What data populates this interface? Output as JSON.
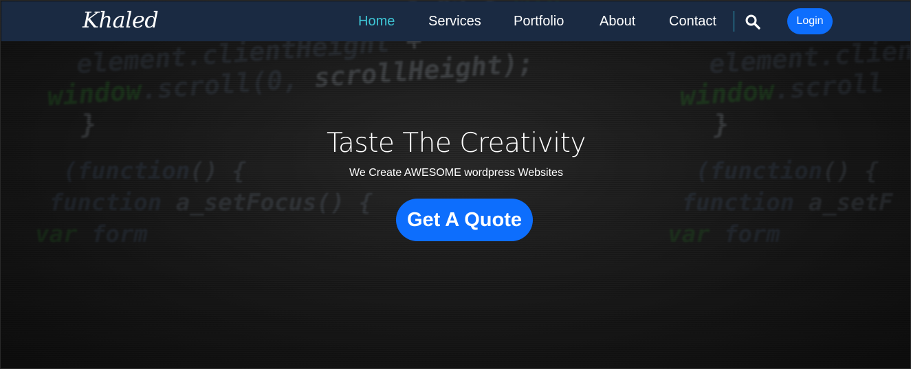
{
  "navbar": {
    "brand": "Khaled",
    "links": [
      {
        "label": "Home",
        "active": true
      },
      {
        "label": "Services",
        "active": false
      },
      {
        "label": "Portfolio",
        "active": false
      },
      {
        "label": "About",
        "active": false
      },
      {
        "label": "Contact",
        "active": false
      }
    ],
    "search_icon": "search-icon",
    "login_label": "Login"
  },
  "hero": {
    "title": "Taste The Creativity",
    "subtitle": "We Create AWESOME wordpress Websites",
    "cta_label": "Get A Quote"
  },
  "background_code": {
    "line1": "var scrollHeight = 0.02 * win",
    "line2": "element.clientHeight + ",
    "line3": "window.scroll(0, scrollHeight);",
    "line4": "}",
    "line5": "(function() {",
    "line6": "function a_setFocus() {",
    "line7": "var form"
  },
  "colors": {
    "navbar_bg": "#1a2a42",
    "active_link": "#3ec6d6",
    "primary_button": "#0d6efd",
    "text": "#ffffff"
  }
}
